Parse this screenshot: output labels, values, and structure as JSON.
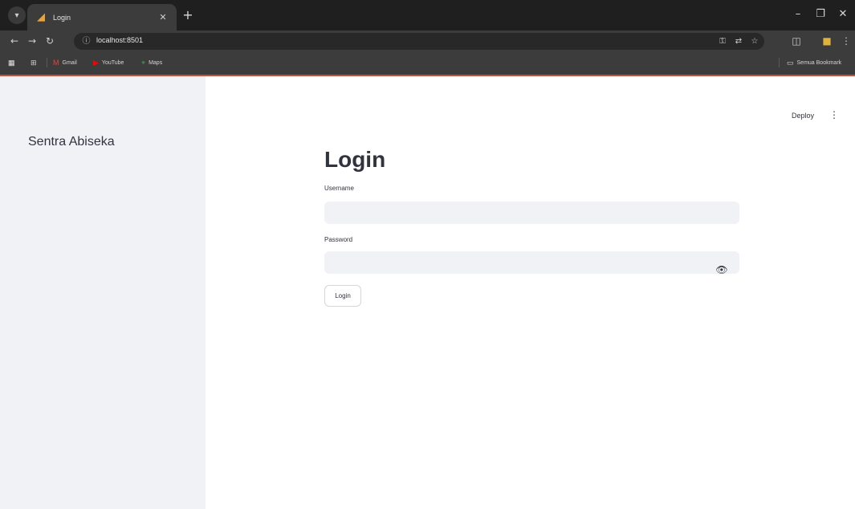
{
  "browser": {
    "tab": {
      "title": "Login"
    },
    "url": "localhost:8501",
    "bookmarks": [
      {
        "label": "Gmail",
        "icon": "gmail-icon"
      },
      {
        "label": "YouTube",
        "icon": "youtube-icon"
      },
      {
        "label": "Maps",
        "icon": "maps-icon"
      }
    ],
    "all_bookmarks_label": "Semua Bookmark",
    "accent_color": "#c4523a"
  },
  "header": {
    "deploy_label": "Deploy"
  },
  "sidebar": {
    "title": "Sentra Abiseka"
  },
  "form": {
    "title": "Login",
    "username_label": "Username",
    "username_value": "",
    "password_label": "Password",
    "password_value": "",
    "submit_label": "Login"
  },
  "colors": {
    "sidebar_bg": "#f0f2f6",
    "text": "#31333f",
    "input_bg": "#f0f2f6"
  }
}
